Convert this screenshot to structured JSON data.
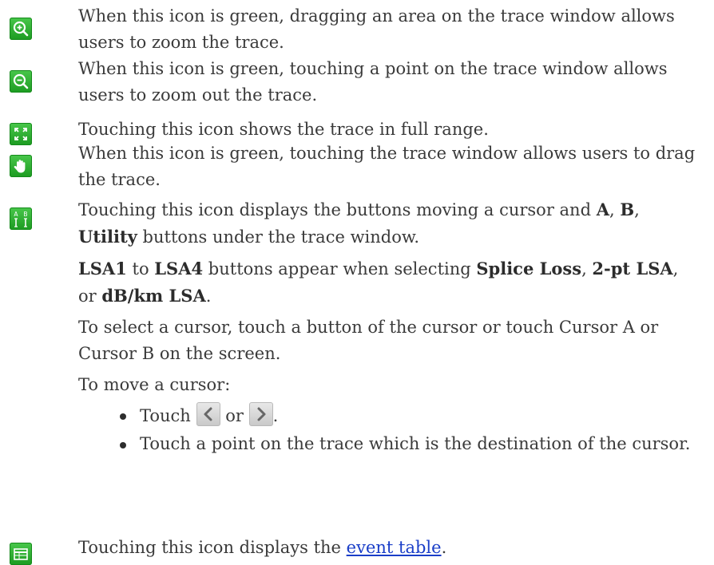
{
  "rows": [
    {
      "icon": "zoom-in-icon",
      "text": "When this icon is green, dragging an area on the trace window allows users to zoom the trace."
    },
    {
      "icon": "zoom-out-icon",
      "text": "When this icon is green, touching a point on the trace window allows users to zoom out the trace."
    },
    {
      "icon": "full-range-icon",
      "text": "Touching this icon shows the trace in full range."
    },
    {
      "icon": "hand-drag-icon",
      "text": "When this icon is green, touching the trace window allows users to drag the trace."
    },
    {
      "icon": "cursor-ab-icon",
      "text_part1": "Touching this icon displays the buttons moving a cursor and ",
      "bold_a": "A",
      "sep1": ", ",
      "bold_b": "B",
      "sep2": ",",
      "bold_utility": "Utility",
      "text_part2": " buttons under the trace window."
    },
    {
      "icon": "event-table-icon",
      "text_before": "Touching this icon displays the ",
      "link": "event table",
      "text_after": "."
    }
  ],
  "icon_glyphs": {
    "cursor_a": "A",
    "cursor_b": "B"
  },
  "lsa_note": {
    "bold_lsa1": "LSA1",
    "to": " to ",
    "bold_lsa4": "LSA4",
    "middle": " buttons appear when selecting ",
    "bold_splice": "Splice Loss",
    "comma1": ", ",
    "bold_2pt": "2-pt LSA",
    "comma2": ",",
    "or": " or ",
    "bold_dbkm": "dB/km LSA",
    "end": "."
  },
  "select_cursor": "To select a cursor, touch a button of the cursor or touch Cursor A or Cursor B on the screen.",
  "move_cursor": "To move a cursor:",
  "bullets": {
    "touch": "Touch ",
    "or": " or ",
    "period": ".",
    "point": "Touch a point on the trace which is the destination of the cursor."
  },
  "colors": {
    "icon_green": "#2fae33",
    "link_blue": "#1a3ec8",
    "text": "#3a3a3a"
  }
}
